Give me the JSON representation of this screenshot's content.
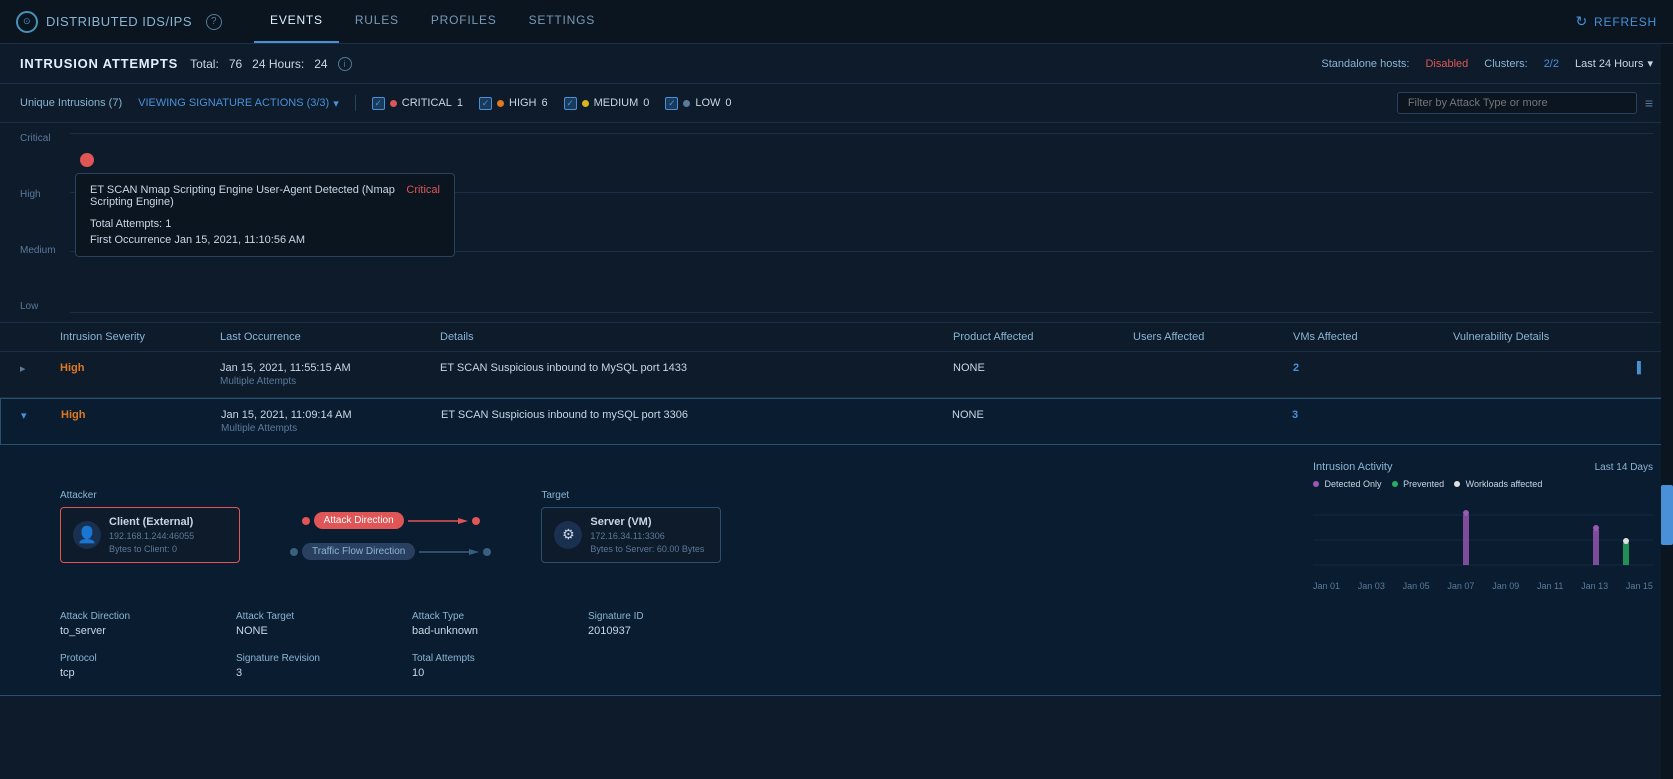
{
  "app": {
    "title": "DISTRIBUTED IDS/IPS",
    "help_label": "?"
  },
  "nav": {
    "tabs": [
      "EVENTS",
      "RULES",
      "PROFILES",
      "SETTINGS"
    ],
    "active_tab": "EVENTS",
    "refresh_label": "REFRESH"
  },
  "section": {
    "title": "INTRUSION ATTEMPTS",
    "total_label": "Total:",
    "total_value": "76",
    "hours_label": "24 Hours:",
    "hours_value": "24",
    "standalone_label": "Standalone hosts:",
    "standalone_value": "Disabled",
    "clusters_label": "Clusters:",
    "clusters_value": "2/2",
    "time_range": "Last 24 Hours"
  },
  "filters": {
    "unique_label": "Unique Intrusions (7)",
    "viewing_label": "VIEWING SIGNATURE ACTIONS (3/3)",
    "chips": [
      {
        "id": "critical",
        "label": "CRITICAL",
        "count": "1",
        "dot_color": "red",
        "checked": true
      },
      {
        "id": "high",
        "label": "HIGH",
        "count": "6",
        "dot_color": "orange",
        "checked": true
      },
      {
        "id": "medium",
        "label": "MEDIUM",
        "count": "0",
        "dot_color": "yellow",
        "checked": true
      },
      {
        "id": "low",
        "label": "LOW",
        "count": "0",
        "dot_color": "gray",
        "checked": true
      }
    ],
    "filter_placeholder": "Filter by Attack Type or more"
  },
  "chart": {
    "y_labels": [
      "Critical",
      "High",
      "Medium",
      "Low"
    ],
    "tooltip": {
      "title": "ET SCAN Nmap Scripting Engine User-Agent Detected (Nmap Scripting Engine)",
      "severity": "Critical",
      "attempts_label": "Total Attempts:",
      "attempts_value": "1",
      "occurrence_label": "First Occurrence",
      "occurrence_value": "Jan 15, 2021, 11:10:56 AM"
    }
  },
  "table": {
    "headers": [
      "",
      "Intrusion Severity",
      "Last Occurrence",
      "Details",
      "Product Affected",
      "Users Affected",
      "VMs Affected",
      "Vulnerability Details",
      ""
    ],
    "rows": [
      {
        "id": 1,
        "severity": "High",
        "severity_class": "high",
        "last_occurrence": "Jan 15, 2021, 11:55:15 AM",
        "occurrence_sub": "Multiple Attempts",
        "details": "ET SCAN Suspicious inbound to MySQL port 1433",
        "product": "NONE",
        "users": "",
        "vms": "2",
        "vuln": "",
        "expanded": false
      },
      {
        "id": 2,
        "severity": "High",
        "severity_class": "high",
        "last_occurrence": "Jan 15, 2021, 11:09:14 AM",
        "occurrence_sub": "Multiple Attempts",
        "details": "ET SCAN Suspicious inbound to mySQL port 3306",
        "product": "NONE",
        "users": "",
        "vms": "3",
        "vuln": "",
        "expanded": true
      }
    ]
  },
  "expanded_row": {
    "attacker_label": "Attacker",
    "target_label": "Target",
    "attack_dir_btn": "Attack Direction",
    "traffic_dir_btn": "Traffic Flow Direction",
    "attacker_name": "Client (External)",
    "attacker_ip": "192.168.1.244:46055",
    "attacker_bytes": "Bytes to Client: 0",
    "target_name": "Server (VM)",
    "target_ip": "172.16.34.11:3306",
    "target_bytes": "Bytes to Server: 60.00 Bytes",
    "fields": [
      {
        "label": "Attack Direction",
        "value": "to_server"
      },
      {
        "label": "Attack Target",
        "value": "NONE"
      },
      {
        "label": "Attack Type",
        "value": "bad-unknown"
      },
      {
        "label": "Signature ID",
        "value": "2010937"
      },
      {
        "label": "Protocol",
        "value": "tcp"
      },
      {
        "label": "Signature Revision",
        "value": "3"
      },
      {
        "label": "Total Attempts",
        "value": "10"
      }
    ],
    "chart": {
      "title": "Intrusion Activity",
      "subtitle": "Last 14 Days",
      "legend": [
        {
          "label": "Detected Only",
          "color": "#9b59b6"
        },
        {
          "label": "Prevented",
          "color": "#27ae60"
        },
        {
          "label": "Workloads affected",
          "color": "#e0e0e0"
        }
      ],
      "x_labels": [
        "Jan 01",
        "Jan 03",
        "Jan 05",
        "Jan 07",
        "Jan 09",
        "Jan 11",
        "Jan 13",
        "Jan 15"
      ],
      "bars": [
        {
          "x": 0.45,
          "height": 0.5,
          "color": "#9b59b6"
        },
        {
          "x": 0.88,
          "height": 0.8,
          "color": "#9b59b6"
        },
        {
          "x": 0.92,
          "height": 0.4,
          "color": "#27ae60"
        }
      ]
    }
  },
  "icons": {
    "chevron_down": "▾",
    "chevron_right": "▸",
    "refresh": "↻",
    "lines": "≡",
    "circle": "●",
    "check": "✓"
  }
}
